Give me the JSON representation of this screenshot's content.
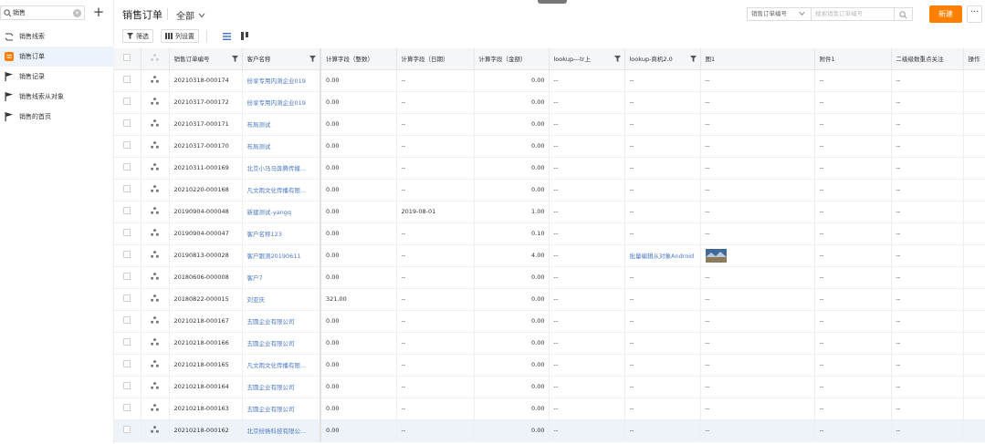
{
  "sidebar": {
    "search_value": "销售",
    "search_placeholder": "",
    "items": [
      {
        "label": "销售线索",
        "icon": "clue-icon",
        "active": false
      },
      {
        "label": "销售订单",
        "icon": "order-icon",
        "active": true
      },
      {
        "label": "销售记录",
        "icon": "flag-icon",
        "active": false
      },
      {
        "label": "销售线索从对象",
        "icon": "flag-icon",
        "active": false
      },
      {
        "label": "销售的首页",
        "icon": "flag-icon",
        "active": false
      }
    ]
  },
  "header": {
    "title": "销售订单",
    "view_label": "全部",
    "search_field_label": "销售订单编号",
    "search_placeholder": "搜索销售订单编号",
    "new_label": "新建",
    "more_label": "···"
  },
  "toolbar": {
    "filter_label": "筛选",
    "columns_label": "列设置"
  },
  "colors": {
    "accent": "#ff8000",
    "link": "#4a78c2",
    "active_bg": "#edf3fb"
  },
  "table": {
    "headers": [
      "销售订单编号",
      "客户名称",
      "计算字段（整数）",
      "计算字段（日期）",
      "计算字段（金额）",
      "lookup---tr上",
      "lookup-商机2.0",
      "图1",
      "附件1",
      "二级级数重点关注",
      "操作"
    ],
    "rows": [
      {
        "id": "20210318-000174",
        "customer": "纷享专用内测企业019",
        "int": "0.00",
        "date": "--",
        "amount": "0.00",
        "lookup1": "--",
        "lookup2": "--",
        "img": "--",
        "attach": "--",
        "level": "--"
      },
      {
        "id": "20210317-000172",
        "customer": "纷享专用内测企业019",
        "int": "0.00",
        "date": "--",
        "amount": "0.00",
        "lookup1": "--",
        "lookup2": "--",
        "img": "--",
        "attach": "--",
        "level": "--"
      },
      {
        "id": "20210317-000171",
        "customer": "布局测试",
        "int": "0.00",
        "date": "--",
        "amount": "0.00",
        "lookup1": "--",
        "lookup2": "--",
        "img": "--",
        "attach": "--",
        "level": "--"
      },
      {
        "id": "20210317-000170",
        "customer": "布局测试",
        "int": "0.00",
        "date": "--",
        "amount": "0.00",
        "lookup1": "--",
        "lookup2": "--",
        "img": "--",
        "attach": "--",
        "level": "--"
      },
      {
        "id": "20210311-000169",
        "customer": "北京小马马奔腾传媒...",
        "int": "0.00",
        "date": "--",
        "amount": "0.00",
        "lookup1": "--",
        "lookup2": "--",
        "img": "--",
        "attach": "--",
        "level": "--"
      },
      {
        "id": "20210220-000168",
        "customer": "凡文雨文化传播有限...",
        "int": "0.00",
        "date": "--",
        "amount": "0.00",
        "lookup1": "--",
        "lookup2": "--",
        "img": "--",
        "attach": "--",
        "level": "--"
      },
      {
        "id": "20190904-000048",
        "customer": "新建测试-yangq",
        "int": "0.00",
        "date": "2019-08-01",
        "amount": "1.00",
        "lookup1": "--",
        "lookup2": "--",
        "img": "--",
        "attach": "--",
        "level": "--"
      },
      {
        "id": "20190904-000047",
        "customer": "客户名称123",
        "int": "0.00",
        "date": "--",
        "amount": "0.10",
        "lookup1": "--",
        "lookup2": "--",
        "img": "--",
        "attach": "--",
        "level": "--"
      },
      {
        "id": "20190813-000028",
        "customer": "客户跟测20190611",
        "int": "0.00",
        "date": "--",
        "amount": "4.00",
        "lookup1": "--",
        "lookup2": "批量编辑从对象Android",
        "img": "",
        "attach": "--",
        "level": "--"
      },
      {
        "id": "20180606-000008",
        "customer": "客户7",
        "int": "0.00",
        "date": "--",
        "amount": "0.00",
        "lookup1": "--",
        "lookup2": "--",
        "img": "--",
        "attach": "--",
        "level": "--"
      },
      {
        "id": "20180822-000015",
        "customer": "刘亚庆",
        "int": "321.00",
        "date": "--",
        "amount": "0.00",
        "lookup1": "--",
        "lookup2": "--",
        "img": "--",
        "attach": "--",
        "level": "--"
      },
      {
        "id": "20210218-000167",
        "customer": "五圆企业有限公司",
        "int": "0.00",
        "date": "--",
        "amount": "0.00",
        "lookup1": "--",
        "lookup2": "--",
        "img": "--",
        "attach": "--",
        "level": "--"
      },
      {
        "id": "20210218-000166",
        "customer": "五圆企业有限公司",
        "int": "0.00",
        "date": "--",
        "amount": "0.00",
        "lookup1": "--",
        "lookup2": "--",
        "img": "--",
        "attach": "--",
        "level": "--"
      },
      {
        "id": "20210218-000165",
        "customer": "凡文雨文化传播有限...",
        "int": "0.00",
        "date": "--",
        "amount": "0.00",
        "lookup1": "--",
        "lookup2": "--",
        "img": "--",
        "attach": "--",
        "level": "--"
      },
      {
        "id": "20210218-000164",
        "customer": "五圆企业有限公司",
        "int": "0.00",
        "date": "--",
        "amount": "0.00",
        "lookup1": "--",
        "lookup2": "--",
        "img": "--",
        "attach": "--",
        "level": "--"
      },
      {
        "id": "20210218-000163",
        "customer": "五圆企业有限公司",
        "int": "0.00",
        "date": "--",
        "amount": "0.00",
        "lookup1": "--",
        "lookup2": "--",
        "img": "--",
        "attach": "--",
        "level": "--"
      },
      {
        "id": "20210218-000162",
        "customer": "北京纷扬科技有限公...",
        "int": "0.00",
        "date": "--",
        "amount": "0.00",
        "lookup1": "--",
        "lookup2": "--",
        "img": "--",
        "attach": "--",
        "level": "--"
      }
    ]
  }
}
